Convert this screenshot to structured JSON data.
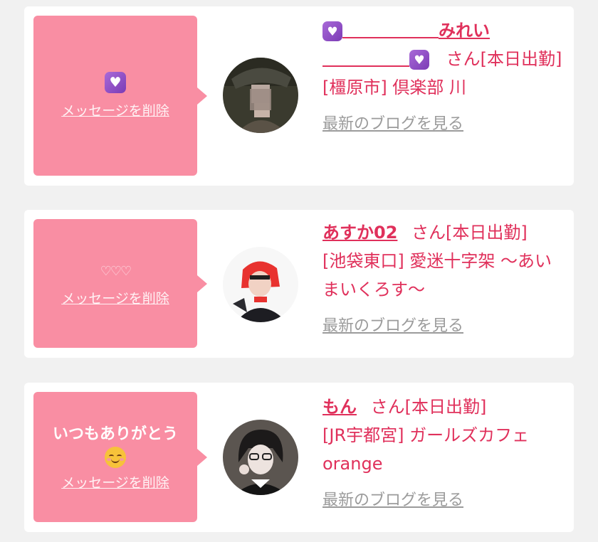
{
  "cards": [
    {
      "message_icon": "purple-heart-emoji",
      "message_text": "💜",
      "delete_label": "メッセージを削除",
      "name": "みれい",
      "name_prefix_icon": "purple-heart-emoji",
      "name_suffix_icon": "purple-heart-emoji",
      "suffix": "さん[本日出勤]",
      "shop": "[橿原市] 倶楽部 川",
      "blog_label": "最新のブログを見る",
      "avatar_icon": "avatar-blurred-photo"
    },
    {
      "message_text": "♡♡♡",
      "delete_label": "メッセージを削除",
      "name": "あすか02",
      "suffix": "さん[本日出勤]",
      "shop": "[池袋東口] 愛迷十字架 〜あいまいくろす〜",
      "blog_label": "最新のブログを見る",
      "avatar_icon": "avatar-red-hair-photo"
    },
    {
      "message_text": "いつもありがとう",
      "message_icon": "smiling-face-emoji",
      "delete_label": "メッセージを削除",
      "name": "もん",
      "suffix": "さん[本日出勤]",
      "shop": "[JR宇都宮] ガールズカフェorange",
      "blog_label": "最新のブログを見る",
      "avatar_icon": "avatar-glasses-photo"
    }
  ],
  "colors": {
    "accent_pink": "#e0305b",
    "bubble_pink": "#f98ea3",
    "link_gray": "#9b9b9b"
  }
}
